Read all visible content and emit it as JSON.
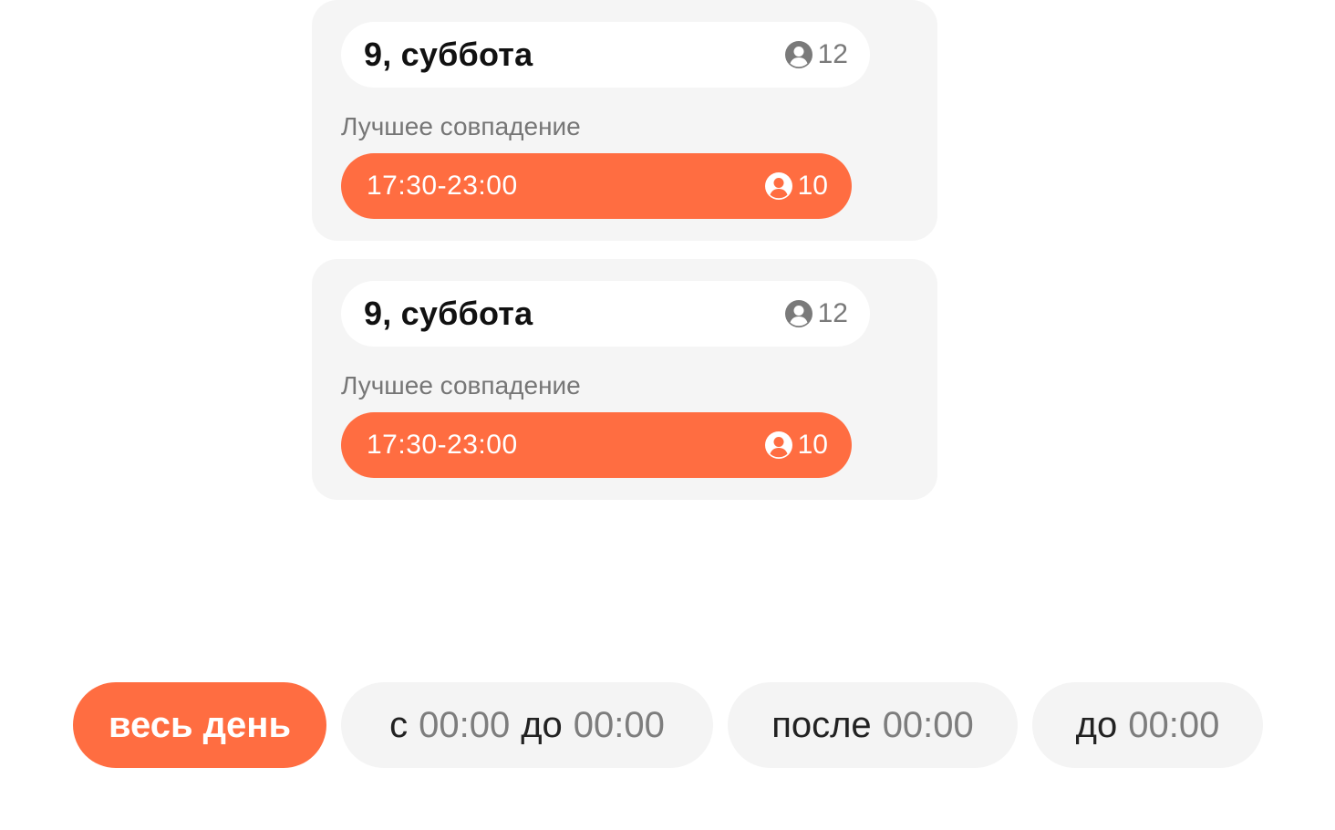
{
  "cards": [
    {
      "day_title": "9, суббота",
      "day_count": "12",
      "best_label": "Лучшее совпадение",
      "slot_time": "17:30-23:00",
      "slot_count": "10"
    },
    {
      "day_title": "9, суббота",
      "day_count": "12",
      "best_label": "Лучшее совпадение",
      "slot_time": "17:30-23:00",
      "slot_count": "10"
    }
  ],
  "filters": {
    "all_day": "весь день",
    "range": {
      "from_word": "с",
      "from_time": "00:00",
      "to_word": "до",
      "to_time": "00:00"
    },
    "after": {
      "word": "после",
      "time": "00:00"
    },
    "before": {
      "word": "до",
      "time": "00:00"
    }
  },
  "icons": {
    "participants": "person-circle-icon"
  },
  "colors": {
    "accent": "#ff6d41",
    "card_bg": "#f5f5f5",
    "chip_bg": "#f4f4f4",
    "muted_text": "#767676"
  }
}
